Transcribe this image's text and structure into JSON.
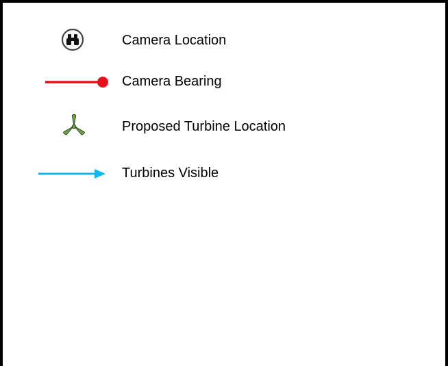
{
  "legend": {
    "items": [
      {
        "label": "Camera Location",
        "icon": "binoculars-icon"
      },
      {
        "label": "Camera Bearing",
        "icon": "line-with-dot-icon",
        "color": "#e8101a"
      },
      {
        "label": "Proposed Turbine Location",
        "icon": "turbine-icon",
        "color": "#6fa543"
      },
      {
        "label": "Turbines Visible",
        "icon": "arrow-right-icon",
        "color": "#12b8ee"
      }
    ]
  }
}
